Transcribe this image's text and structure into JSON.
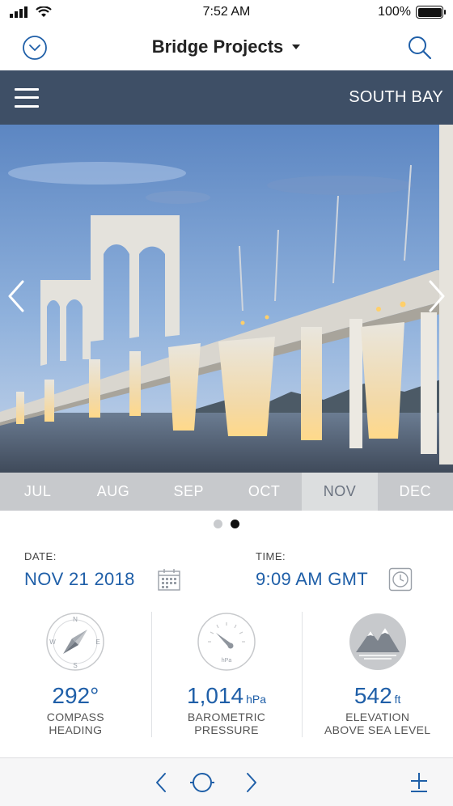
{
  "status_bar": {
    "time": "7:52 AM",
    "battery": "100%"
  },
  "nav": {
    "title": "Bridge Projects"
  },
  "header": {
    "location": "SOUTH BAY"
  },
  "months": [
    "JUL",
    "AUG",
    "SEP",
    "OCT",
    "NOV",
    "DEC"
  ],
  "selected_month": "NOV",
  "pager": {
    "pages": 2,
    "current": 2
  },
  "date": {
    "label": "DATE:",
    "value": "NOV 21 2018"
  },
  "time": {
    "label": "TIME:",
    "value": "9:09 AM GMT"
  },
  "gauges": {
    "compass": {
      "value": "292°",
      "line1": "COMPASS",
      "line2": "HEADING"
    },
    "pressure": {
      "value": "1,014",
      "unit": "hPa",
      "icon_label": "hPa",
      "line1": "BAROMETRIC",
      "line2": "PRESSURE"
    },
    "elevation": {
      "value": "542",
      "unit": "ft",
      "line1": "ELEVATION",
      "line2": "ABOVE SEA LEVEL"
    }
  },
  "compass_letters": {
    "n": "N",
    "e": "E",
    "s": "S",
    "w": "W"
  },
  "colors": {
    "accent": "#1f5fa8",
    "header_bar": "#3e4f66",
    "month_strip": "#c7c9cc"
  }
}
